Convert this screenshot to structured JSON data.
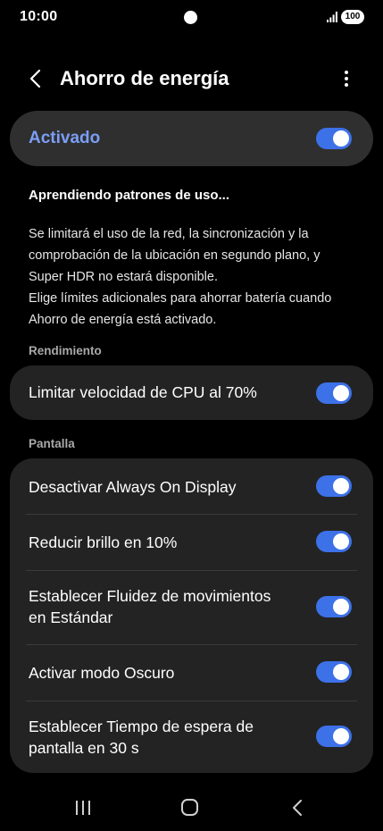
{
  "status": {
    "time": "10:00",
    "battery": "100"
  },
  "header": {
    "title": "Ahorro de energía"
  },
  "master_toggle": {
    "label": "Activado",
    "on": true
  },
  "info": {
    "title": "Aprendiendo patrones de uso...",
    "line1": "Se limitará el uso de la red, la sincronización y la",
    "line2": "comprobación de la ubicación en segundo plano, y",
    "line3": "Super HDR no estará disponible.",
    "line4": "Elige límites adicionales para ahorrar batería cuando",
    "line5": "Ahorro de energía está activado."
  },
  "sections": [
    {
      "title": "Rendimiento",
      "items": [
        {
          "label": "Limitar velocidad de CPU al 70%",
          "on": true
        }
      ]
    },
    {
      "title": "Pantalla",
      "items": [
        {
          "label": "Desactivar Always On Display",
          "on": true
        },
        {
          "label": "Reducir brillo en 10%",
          "on": true
        },
        {
          "line1": "Establecer Fluidez de movimientos",
          "line2": "en Estándar",
          "on": true
        },
        {
          "label": "Activar modo Oscuro",
          "on": true
        },
        {
          "line1": "Establecer Tiempo de espera de",
          "line2": "pantalla en 30 s",
          "on": true
        }
      ]
    }
  ],
  "colors": {
    "accent": "#3d71e8",
    "accent_text": "#7b9ef6",
    "card": "#232323"
  },
  "icons": [
    "back-arrow-icon",
    "more-options-icon",
    "signal-icon",
    "battery-icon",
    "recent-apps-icon",
    "home-icon",
    "nav-back-icon"
  ]
}
